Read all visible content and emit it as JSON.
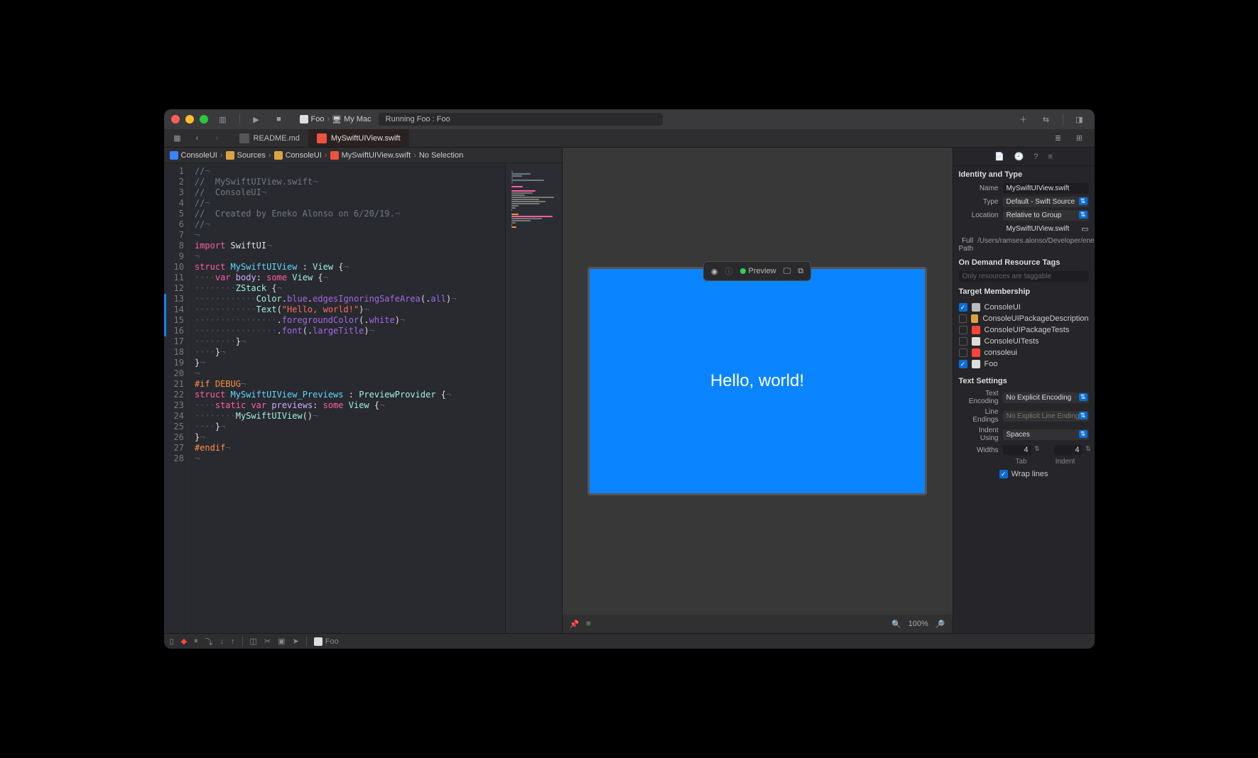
{
  "toolbar": {
    "scheme": "Foo",
    "destination": "My Mac",
    "status": "Running Foo : Foo"
  },
  "tabs": [
    {
      "name": "README.md",
      "active": false
    },
    {
      "name": "MySwiftUIView.swift",
      "active": true
    }
  ],
  "breadcrumb": [
    "ConsoleUI",
    "Sources",
    "ConsoleUI",
    "MySwiftUIView.swift",
    "No Selection"
  ],
  "code_lines": [
    [
      {
        "cls": "c-cmt",
        "t": "//"
      }
    ],
    [
      {
        "cls": "c-cmt",
        "t": "//  MySwiftUIView.swift"
      }
    ],
    [
      {
        "cls": "c-cmt",
        "t": "//  ConsoleUI"
      }
    ],
    [
      {
        "cls": "c-cmt",
        "t": "//"
      }
    ],
    [
      {
        "cls": "c-cmt",
        "t": "//  Created by Eneko Alonso on 6/20/19."
      }
    ],
    [
      {
        "cls": "c-cmt",
        "t": "//"
      }
    ],
    [],
    [
      {
        "cls": "c-kw",
        "t": "import"
      },
      {
        "cls": "c-plain",
        "t": " SwiftUI"
      }
    ],
    [],
    [
      {
        "cls": "c-kw",
        "t": "struct"
      },
      {
        "cls": "c-plain",
        "t": " "
      },
      {
        "cls": "c-typedef",
        "t": "MySwiftUIView"
      },
      {
        "cls": "c-plain",
        "t": " : "
      },
      {
        "cls": "c-type",
        "t": "View"
      },
      {
        "cls": "c-plain",
        "t": " {"
      }
    ],
    [
      {
        "cls": "invis",
        "t": "····"
      },
      {
        "cls": "c-kw",
        "t": "var"
      },
      {
        "cls": "c-plain",
        "t": " "
      },
      {
        "cls": "c-attr",
        "t": "body"
      },
      {
        "cls": "c-plain",
        "t": ": "
      },
      {
        "cls": "c-kw",
        "t": "some"
      },
      {
        "cls": "c-plain",
        "t": " "
      },
      {
        "cls": "c-type",
        "t": "View"
      },
      {
        "cls": "c-plain",
        "t": " {"
      }
    ],
    [
      {
        "cls": "invis",
        "t": "········"
      },
      {
        "cls": "c-type",
        "t": "ZStack"
      },
      {
        "cls": "c-plain",
        "t": " {"
      }
    ],
    [
      {
        "cls": "invis",
        "t": "············"
      },
      {
        "cls": "c-type",
        "t": "Color"
      },
      {
        "cls": "c-plain",
        "t": "."
      },
      {
        "cls": "c-func",
        "t": "blue"
      },
      {
        "cls": "c-plain",
        "t": "."
      },
      {
        "cls": "c-func",
        "t": "edgesIgnoringSafeArea"
      },
      {
        "cls": "c-plain",
        "t": "(."
      },
      {
        "cls": "c-func",
        "t": "all"
      },
      {
        "cls": "c-plain",
        "t": ")"
      }
    ],
    [
      {
        "cls": "invis",
        "t": "············"
      },
      {
        "cls": "c-type",
        "t": "Text"
      },
      {
        "cls": "c-plain",
        "t": "("
      },
      {
        "cls": "c-str",
        "t": "\"Hello, world!\""
      },
      {
        "cls": "c-plain",
        "t": ")"
      }
    ],
    [
      {
        "cls": "invis",
        "t": "················"
      },
      {
        "cls": "c-plain",
        "t": "."
      },
      {
        "cls": "c-func",
        "t": "foregroundColor"
      },
      {
        "cls": "c-plain",
        "t": "(."
      },
      {
        "cls": "c-func",
        "t": "white"
      },
      {
        "cls": "c-plain",
        "t": ")"
      }
    ],
    [
      {
        "cls": "invis",
        "t": "················"
      },
      {
        "cls": "c-plain",
        "t": "."
      },
      {
        "cls": "c-func",
        "t": "font"
      },
      {
        "cls": "c-plain",
        "t": "(."
      },
      {
        "cls": "c-func",
        "t": "largeTitle"
      },
      {
        "cls": "c-plain",
        "t": ")"
      }
    ],
    [
      {
        "cls": "invis",
        "t": "········"
      },
      {
        "cls": "c-plain",
        "t": "}"
      }
    ],
    [
      {
        "cls": "invis",
        "t": "····"
      },
      {
        "cls": "c-plain",
        "t": "}"
      }
    ],
    [
      {
        "cls": "c-plain",
        "t": "}"
      }
    ],
    [],
    [
      {
        "cls": "c-pre",
        "t": "#if"
      },
      {
        "cls": "c-plain",
        "t": " "
      },
      {
        "cls": "c-pre",
        "t": "DEBUG"
      }
    ],
    [
      {
        "cls": "c-kw",
        "t": "struct"
      },
      {
        "cls": "c-plain",
        "t": " "
      },
      {
        "cls": "c-typedef",
        "t": "MySwiftUIView_Previews"
      },
      {
        "cls": "c-plain",
        "t": " : "
      },
      {
        "cls": "c-type",
        "t": "PreviewProvider"
      },
      {
        "cls": "c-plain",
        "t": " {"
      }
    ],
    [
      {
        "cls": "invis",
        "t": "····"
      },
      {
        "cls": "c-kw",
        "t": "static"
      },
      {
        "cls": "c-plain",
        "t": " "
      },
      {
        "cls": "c-kw",
        "t": "var"
      },
      {
        "cls": "c-plain",
        "t": " "
      },
      {
        "cls": "c-attr",
        "t": "previews"
      },
      {
        "cls": "c-plain",
        "t": ": "
      },
      {
        "cls": "c-kw",
        "t": "some"
      },
      {
        "cls": "c-plain",
        "t": " "
      },
      {
        "cls": "c-type",
        "t": "View"
      },
      {
        "cls": "c-plain",
        "t": " {"
      }
    ],
    [
      {
        "cls": "invis",
        "t": "········"
      },
      {
        "cls": "c-type",
        "t": "MySwiftUIView"
      },
      {
        "cls": "c-plain",
        "t": "()"
      }
    ],
    [
      {
        "cls": "invis",
        "t": "····"
      },
      {
        "cls": "c-plain",
        "t": "}"
      }
    ],
    [
      {
        "cls": "c-plain",
        "t": "}"
      }
    ],
    [
      {
        "cls": "c-pre",
        "t": "#endif"
      }
    ],
    []
  ],
  "changed_lines": [
    13,
    14,
    15,
    16
  ],
  "preview": {
    "label": "Preview",
    "text": "Hello, world!",
    "zoom": "100%"
  },
  "inspector": {
    "identity_title": "Identity and Type",
    "name_label": "Name",
    "name": "MySwiftUIView.swift",
    "type_label": "Type",
    "type": "Default - Swift Source",
    "location_label": "Location",
    "location": "Relative to Group",
    "location_file": "MySwiftUIView.swift",
    "fullpath_label": "Full Path",
    "fullpath": "/Users/ramses.alonso/Developer/eneko/ConsoleUI/Sources/ConsoleUI/MySwiftUIView.swift",
    "ondemand_title": "On Demand Resource Tags",
    "ondemand_placeholder": "Only resources are taggable",
    "target_title": "Target Membership",
    "targets": [
      {
        "checked": true,
        "color": "#bbb",
        "name": "ConsoleUI"
      },
      {
        "checked": false,
        "color": "#d9a441",
        "name": "ConsoleUIPackageDescription"
      },
      {
        "checked": false,
        "color": "#ff453a",
        "name": "ConsoleUIPackageTests"
      },
      {
        "checked": false,
        "color": "#ddd",
        "name": "ConsoleUITests"
      },
      {
        "checked": false,
        "color": "#ff453a",
        "name": "consoleui"
      },
      {
        "checked": true,
        "color": "#ddd",
        "name": "Foo"
      }
    ],
    "text_title": "Text Settings",
    "encoding_label": "Text Encoding",
    "encoding": "No Explicit Encoding",
    "lineendings_label": "Line Endings",
    "lineendings": "No Explicit Line Endings",
    "indent_label": "Indent Using",
    "indent_using": "Spaces",
    "widths_label": "Widths",
    "tab_width": "4",
    "indent_width": "4",
    "tab_label": "Tab",
    "indent_width_label": "Indent",
    "wrap_label": "Wrap lines"
  },
  "debugbar": {
    "process": "Foo"
  }
}
